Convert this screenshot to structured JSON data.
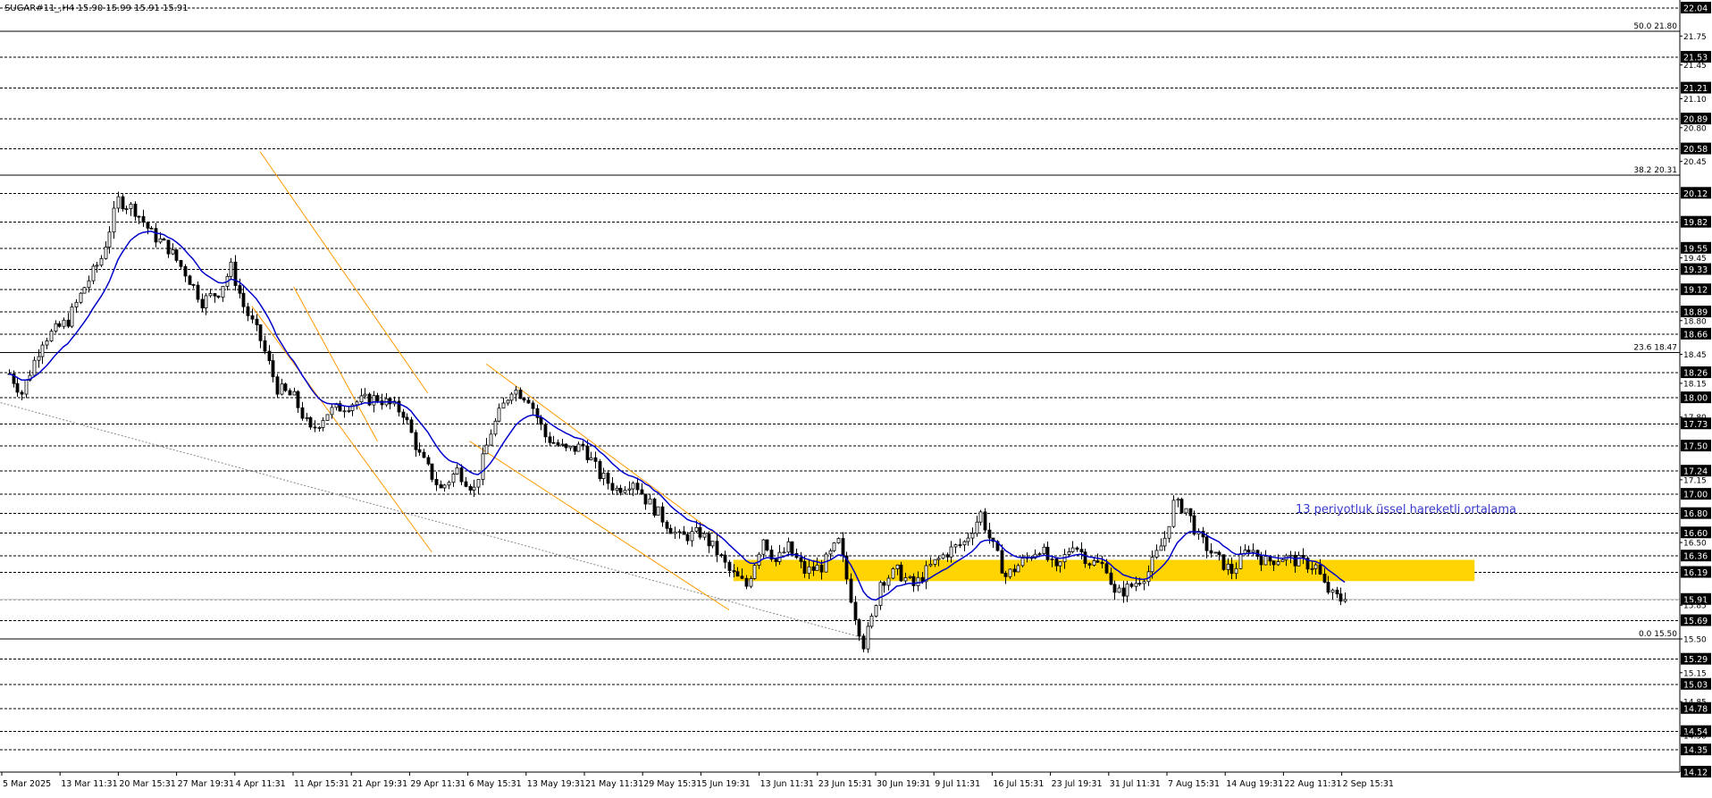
{
  "window": {
    "ticker": "SUGAR#11_,H4  15.90 15.99 15.91 15.91"
  },
  "colors": {
    "background": "#ffffff",
    "candle": "#000000",
    "ema": "#0000cc",
    "channel": "#ff9900",
    "support_zone": "#ffd400",
    "grid": "#000000",
    "price_box_bg": "#000000",
    "price_box_text": "#ffffff"
  },
  "annotation": {
    "ema_label": "13 periyotluk üssel hareketli ortalama"
  },
  "chart_data": {
    "type": "candlestick",
    "symbol": "SUGAR#11",
    "timeframe": "H4",
    "ohlc_last": {
      "open": 15.9,
      "high": 15.99,
      "low": 15.91,
      "close": 15.91
    },
    "ylim": [
      14.12,
      22.04
    ],
    "grid": "horizontal dashed at level boxes",
    "x_tick_labels": [
      "5 Mar 2025",
      "13 Mar 11:31",
      "20 Mar 15:31",
      "27 Mar 19:31",
      "4 Apr 11:31",
      "11 Apr 15:31",
      "21 Apr 19:31",
      "29 Apr 11:31",
      "6 May 15:31",
      "13 May 19:31",
      "21 May 11:31",
      "29 May 15:31",
      "5 Jun 19:31",
      "13 Jun 11:31",
      "23 Jun 15:31",
      "30 Jun 19:31",
      "9 Jul 11:31",
      "16 Jul 15:31",
      "23 Jul 19:31",
      "31 Jul 11:31",
      "7 Aug 15:31",
      "14 Aug 19:31",
      "22 Aug 11:31",
      "2 Sep 15:31"
    ],
    "y_tick_labels": [
      "21.75",
      "21.45",
      "21.10",
      "20.80",
      "20.45",
      "19.45",
      "18.80",
      "18.45",
      "18.15",
      "17.80",
      "17.15",
      "16.50",
      "15.85",
      "15.50",
      "15.15",
      "14.85",
      "14.50"
    ],
    "level_boxes": [
      "22.04",
      "21.53",
      "21.21",
      "20.89",
      "20.58",
      "20.12",
      "19.82",
      "19.55",
      "19.33",
      "19.12",
      "18.89",
      "18.66",
      "18.26",
      "18.00",
      "17.73",
      "17.50",
      "17.24",
      "17.00",
      "16.80",
      "16.60",
      "16.36",
      "16.19",
      "15.91",
      "15.69",
      "15.29",
      "15.03",
      "14.78",
      "14.54",
      "14.35",
      "14.12"
    ],
    "fibonacci": [
      {
        "label": "50.0 21.80",
        "value": 21.8
      },
      {
        "label": "38.2 20.31",
        "value": 20.31
      },
      {
        "label": "23.6 18.47",
        "value": 18.47
      },
      {
        "label": "0.0 15.50",
        "value": 15.5
      }
    ],
    "support_zone": {
      "low": 16.1,
      "high": 16.32,
      "from_index": 173,
      "to_index": 350
    },
    "close_path": [
      {
        "i": 0,
        "v": 18.25
      },
      {
        "i": 3,
        "v": 18.05
      },
      {
        "i": 8,
        "v": 18.6
      },
      {
        "i": 14,
        "v": 18.8
      },
      {
        "i": 18,
        "v": 19.15
      },
      {
        "i": 22,
        "v": 19.45
      },
      {
        "i": 26,
        "v": 20.05
      },
      {
        "i": 30,
        "v": 19.95
      },
      {
        "i": 34,
        "v": 19.7
      },
      {
        "i": 38,
        "v": 19.55
      },
      {
        "i": 42,
        "v": 19.3
      },
      {
        "i": 46,
        "v": 19.0
      },
      {
        "i": 50,
        "v": 19.1
      },
      {
        "i": 53,
        "v": 19.35
      },
      {
        "i": 56,
        "v": 18.95
      },
      {
        "i": 60,
        "v": 18.6
      },
      {
        "i": 64,
        "v": 18.1
      },
      {
        "i": 68,
        "v": 18.0
      },
      {
        "i": 72,
        "v": 17.65
      },
      {
        "i": 76,
        "v": 17.85
      },
      {
        "i": 82,
        "v": 17.95
      },
      {
        "i": 88,
        "v": 18.0
      },
      {
        "i": 94,
        "v": 17.85
      },
      {
        "i": 98,
        "v": 17.4
      },
      {
        "i": 103,
        "v": 17.05
      },
      {
        "i": 107,
        "v": 17.25
      },
      {
        "i": 111,
        "v": 17.05
      },
      {
        "i": 115,
        "v": 17.65
      },
      {
        "i": 120,
        "v": 18.1
      },
      {
        "i": 124,
        "v": 18.0
      },
      {
        "i": 128,
        "v": 17.6
      },
      {
        "i": 133,
        "v": 17.45
      },
      {
        "i": 137,
        "v": 17.5
      },
      {
        "i": 141,
        "v": 17.2
      },
      {
        "i": 145,
        "v": 17.05
      },
      {
        "i": 149,
        "v": 17.15
      },
      {
        "i": 152,
        "v": 16.95
      },
      {
        "i": 156,
        "v": 16.75
      },
      {
        "i": 160,
        "v": 16.55
      },
      {
        "i": 165,
        "v": 16.6
      },
      {
        "i": 169,
        "v": 16.4
      },
      {
        "i": 172,
        "v": 16.2
      },
      {
        "i": 176,
        "v": 16.05
      },
      {
        "i": 180,
        "v": 16.55
      },
      {
        "i": 183,
        "v": 16.3
      },
      {
        "i": 186,
        "v": 16.45
      },
      {
        "i": 190,
        "v": 16.2
      },
      {
        "i": 194,
        "v": 16.25
      },
      {
        "i": 198,
        "v": 16.5
      },
      {
        "i": 202,
        "v": 15.75
      },
      {
        "i": 204,
        "v": 15.45
      },
      {
        "i": 206,
        "v": 15.7
      },
      {
        "i": 208,
        "v": 16.1
      },
      {
        "i": 212,
        "v": 16.2
      },
      {
        "i": 216,
        "v": 16.05
      },
      {
        "i": 220,
        "v": 16.25
      },
      {
        "i": 224,
        "v": 16.4
      },
      {
        "i": 228,
        "v": 16.5
      },
      {
        "i": 232,
        "v": 16.8
      },
      {
        "i": 234,
        "v": 16.55
      },
      {
        "i": 238,
        "v": 16.15
      },
      {
        "i": 242,
        "v": 16.3
      },
      {
        "i": 246,
        "v": 16.45
      },
      {
        "i": 250,
        "v": 16.2
      },
      {
        "i": 254,
        "v": 16.5
      },
      {
        "i": 258,
        "v": 16.3
      },
      {
        "i": 262,
        "v": 16.25
      },
      {
        "i": 264,
        "v": 15.95
      },
      {
        "i": 268,
        "v": 16.05
      },
      {
        "i": 272,
        "v": 16.2
      },
      {
        "i": 276,
        "v": 16.55
      },
      {
        "i": 278,
        "v": 16.9
      },
      {
        "i": 281,
        "v": 16.85
      },
      {
        "i": 284,
        "v": 16.55
      },
      {
        "i": 288,
        "v": 16.35
      },
      {
        "i": 292,
        "v": 16.2
      },
      {
        "i": 296,
        "v": 16.45
      },
      {
        "i": 300,
        "v": 16.3
      },
      {
        "i": 304,
        "v": 16.35
      },
      {
        "i": 308,
        "v": 16.3
      },
      {
        "i": 312,
        "v": 16.25
      },
      {
        "i": 314,
        "v": 16.05
      },
      {
        "i": 316,
        "v": 15.95
      },
      {
        "i": 318,
        "v": 15.91
      }
    ]
  }
}
